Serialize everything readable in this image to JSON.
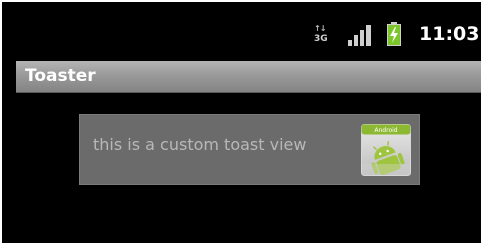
{
  "status_bar": {
    "network_type": "3G",
    "network_icon": "3g-data-icon",
    "signal_icon": "signal-strength-icon",
    "battery_icon": "battery-charging-icon",
    "time": "11:03"
  },
  "title_bar": {
    "title": "Toaster"
  },
  "toast": {
    "message": "this is a custom toast view",
    "icon": "android-app-icon",
    "icon_label": "Android"
  },
  "colors": {
    "background": "#000000",
    "title_bar": "#9a9a9a",
    "toast_background": "#6b6b6b",
    "toast_text": "#b8b8b8",
    "battery_charge": "#7cc52b",
    "android_green": "#9fc540"
  }
}
